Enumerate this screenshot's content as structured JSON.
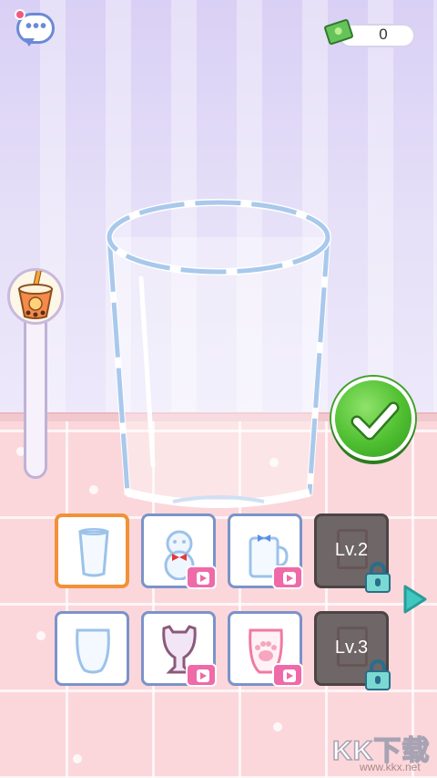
{
  "hud": {
    "money_value": "0",
    "notification": true
  },
  "meter": {
    "fill_fraction": 0.0
  },
  "cups_row1": [
    {
      "id": "plain-cup",
      "selected": true,
      "locked": false,
      "ad": false
    },
    {
      "id": "snowman-cup",
      "selected": false,
      "locked": false,
      "ad": true
    },
    {
      "id": "jar-cup",
      "selected": false,
      "locked": false,
      "ad": true
    },
    {
      "id": "locked-lv2",
      "selected": false,
      "locked": true,
      "ad": false,
      "level_label": "Lv.2"
    }
  ],
  "cups_row2": [
    {
      "id": "tumbler-cup",
      "selected": false,
      "locked": false,
      "ad": false
    },
    {
      "id": "cat-goblet-cup",
      "selected": false,
      "locked": false,
      "ad": true
    },
    {
      "id": "paw-cup",
      "selected": false,
      "locked": false,
      "ad": true
    },
    {
      "id": "locked-lv3",
      "selected": false,
      "locked": true,
      "ad": false,
      "level_label": "Lv.3"
    }
  ],
  "watermark": {
    "logo": "KK下载",
    "url": "www.kkx.net"
  },
  "colors": {
    "accent_green": "#4fbf31",
    "select_orange": "#f29137",
    "ad_pink": "#ef6aa8",
    "frame_blue": "#7b93c9"
  },
  "icons": [
    "chat-icon",
    "cash-icon",
    "check-icon",
    "play-ad-icon",
    "lock-icon",
    "next-arrow-icon"
  ]
}
